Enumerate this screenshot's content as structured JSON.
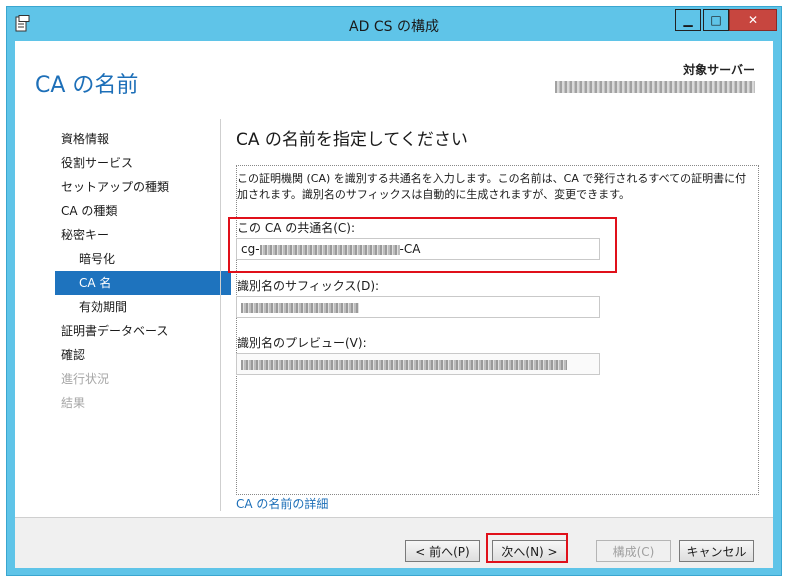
{
  "window": {
    "title": "AD CS の構成",
    "controls": {
      "minimize": "▁",
      "maximize": "□",
      "close": "✕"
    }
  },
  "header": {
    "title": "CA の名前",
    "server_label": "対象サーバー"
  },
  "nav": {
    "items": [
      {
        "label": "資格情報",
        "state": "normal"
      },
      {
        "label": "役割サービス",
        "state": "normal"
      },
      {
        "label": "セットアップの種類",
        "state": "normal"
      },
      {
        "label": "CA の種類",
        "state": "normal"
      },
      {
        "label": "秘密キー",
        "state": "normal"
      },
      {
        "label": "暗号化",
        "state": "sub"
      },
      {
        "label": "CA 名",
        "state": "selected"
      },
      {
        "label": "有効期間",
        "state": "sub"
      },
      {
        "label": "証明書データベース",
        "state": "normal"
      },
      {
        "label": "確認",
        "state": "normal"
      },
      {
        "label": "進行状況",
        "state": "disabled"
      },
      {
        "label": "結果",
        "state": "disabled"
      }
    ]
  },
  "main": {
    "heading": "CA の名前を指定してください",
    "description": "この証明機関 (CA) を識別する共通名を入力します。この名前は、CA で発行されるすべての証明書に付加されます。識別名のサフィックスは自動的に生成されますが、変更できます。",
    "common_name": {
      "label": "この CA の共通名(C):",
      "value_prefix": "cg-",
      "value_suffix": "-CA"
    },
    "dn_suffix": {
      "label": "識別名のサフィックス(D):"
    },
    "dn_preview": {
      "label": "識別名のプレビュー(V):"
    },
    "link": "CA の名前の詳細"
  },
  "buttons": {
    "prev": "< 前へ(P)",
    "next": "次へ(N) >",
    "configure": "構成(C)",
    "cancel": "キャンセル"
  },
  "colors": {
    "title_bar": "#5fc4e8",
    "accent": "#1d6fb8",
    "selected_nav": "#1e73be",
    "highlight_box": "#e0101a"
  }
}
